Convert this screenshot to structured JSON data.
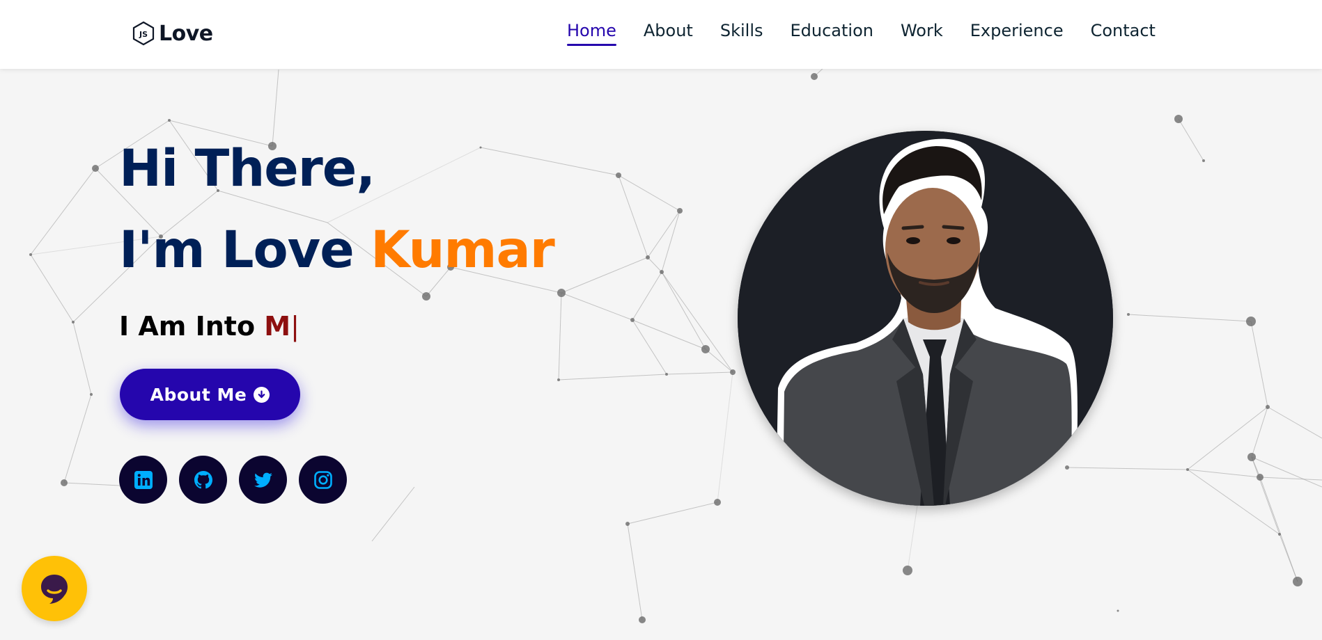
{
  "header": {
    "logo_text": "Love",
    "nav": [
      {
        "label": "Home",
        "active": true
      },
      {
        "label": "About",
        "active": false
      },
      {
        "label": "Skills",
        "active": false
      },
      {
        "label": "Education",
        "active": false
      },
      {
        "label": "Work",
        "active": false
      },
      {
        "label": "Experience",
        "active": false
      },
      {
        "label": "Contact",
        "active": false
      }
    ]
  },
  "hero": {
    "greeting": "Hi There,",
    "intro": "I'm Love ",
    "name_accent": "Kumar",
    "typed_prefix": "I Am Into ",
    "typed_word": "M",
    "typed_cursor": "|",
    "about_button_label": "About Me",
    "social_links": [
      "linkedin-icon",
      "github-icon",
      "twitter-icon",
      "instagram-icon"
    ]
  },
  "colors": {
    "brand_blue": "#2506ad",
    "heading_navy": "#002057",
    "accent_orange": "#ff7b00",
    "typed_red": "#8d0f0f",
    "social_bg": "#0b0530",
    "social_icon": "#00aeff",
    "chat_yellow": "#ffc107",
    "page_bg": "#f5f5f5"
  },
  "icons": {
    "logo": "nodejs-hexagon-icon",
    "about_button": "arrow-down-circle-icon",
    "chat": "chat-bubble-icon"
  }
}
